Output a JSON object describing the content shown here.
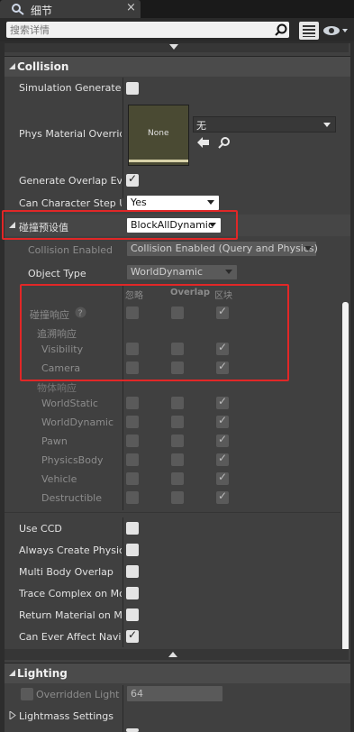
{
  "tab": {
    "title": "细节",
    "close": "×"
  },
  "search": {
    "placeholder": "搜索详情"
  },
  "collision": {
    "title": "Collision",
    "simulation_generates": "Simulation Generates",
    "phys_material_override": "Phys Material Override",
    "thumb_none": "None",
    "material_value": "无",
    "generate_overlap": "Generate Overlap Even",
    "can_step_up": "Can Character Step Up",
    "can_step_up_value": "Yes",
    "preset_label": "碰撞预设值",
    "preset_value": "BlockAllDynamic",
    "collision_enabled_label": "Collision Enabled",
    "collision_enabled_value": "Collision Enabled (Query and Physics)",
    "object_type_label": "Object Type",
    "object_type_value": "WorldDynamic",
    "col_ignore": "忽略",
    "col_overlap": "Overlap",
    "col_block": "区块",
    "response_label": "碰撞响应",
    "trace_label": "追溯响应",
    "object_response_label": "物体响应",
    "rows": {
      "visibility": "Visibility",
      "camera": "Camera",
      "world_static": "WorldStatic",
      "world_dynamic": "WorldDynamic",
      "pawn": "Pawn",
      "physics_body": "PhysicsBody",
      "vehicle": "Vehicle",
      "destructible": "Destructible"
    },
    "use_ccd": "Use CCD",
    "always_create_physics": "Always Create Physics",
    "multi_body_overlap": "Multi Body Overlap",
    "trace_complex": "Trace Complex on Mov",
    "return_material": "Return Material on Mov",
    "can_ever_affect": "Can Ever Affect Naviga"
  },
  "lighting": {
    "title": "Lighting",
    "overridden_light": "Overridden Light M",
    "overridden_value": "64",
    "lightmass_settings": "Lightmass Settings"
  }
}
